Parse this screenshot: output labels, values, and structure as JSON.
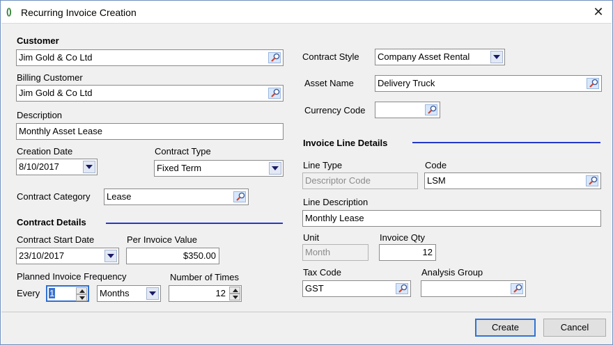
{
  "window": {
    "title": "Recurring Invoice Creation",
    "app_icon": "app-logo-icon",
    "close_glyph": "✕"
  },
  "customer": {
    "section_label": "Customer",
    "value": "Jim Gold & Co Ltd"
  },
  "billing_customer": {
    "label": "Billing Customer",
    "value": "Jim Gold & Co Ltd"
  },
  "description": {
    "label": "Description",
    "value": "Monthly Asset Lease"
  },
  "creation_date": {
    "label": "Creation Date",
    "value": "8/10/2017"
  },
  "contract_type": {
    "label": "Contract Type",
    "value": "Fixed Term"
  },
  "contract_category": {
    "label": "Contract Category",
    "value": "Lease"
  },
  "contract_details": {
    "section_label": "Contract Details",
    "start_date_label": "Contract Start Date",
    "start_date_value": "23/10/2017",
    "per_invoice_label": "Per Invoice Value",
    "per_invoice_value": "$350.00",
    "frequency_label": "Planned Invoice Frequency",
    "every_label": "Every",
    "every_value": "1",
    "period_value": "Months",
    "times_label": "Number of Times",
    "times_value": "12"
  },
  "contract_style": {
    "label": "Contract Style",
    "value": "Company Asset Rental"
  },
  "asset_name": {
    "label": "Asset Name",
    "value": "Delivery Truck"
  },
  "currency_code": {
    "label": "Currency Code",
    "value": ""
  },
  "invoice_line": {
    "section_label": "Invoice Line Details",
    "line_type_label": "Line Type",
    "line_type_value": "Descriptor Code",
    "code_label": "Code",
    "code_value": "LSM",
    "line_description_label": "Line Description",
    "line_description_value": "Monthly Lease",
    "unit_label": "Unit",
    "unit_value": "Month",
    "qty_label": "Invoice Qty",
    "qty_value": "12",
    "tax_code_label": "Tax Code",
    "tax_code_value": "GST",
    "analysis_group_label": "Analysis Group",
    "analysis_group_value": ""
  },
  "footer": {
    "create_label": "Create",
    "cancel_label": "Cancel"
  },
  "colors": {
    "accent_rule": "#2438c8",
    "default_button_border": "#2f73d6"
  }
}
